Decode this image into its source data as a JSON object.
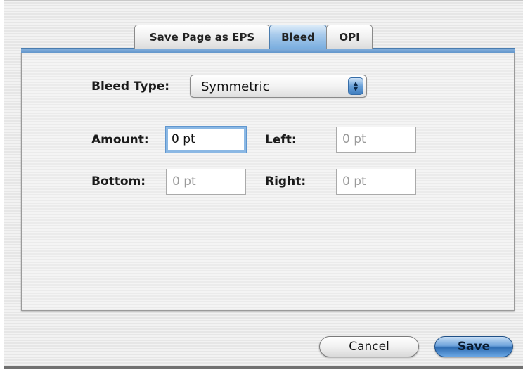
{
  "tabs": [
    {
      "label": "Save Page as EPS",
      "selected": false
    },
    {
      "label": "Bleed",
      "selected": true
    },
    {
      "label": "OPI",
      "selected": false
    }
  ],
  "bleed": {
    "type_label": "Bleed Type:",
    "type_value": "Symmetric",
    "amount_label": "Amount:",
    "amount_value": "0 pt",
    "left_label": "Left:",
    "left_value": "0 pt",
    "bottom_label": "Bottom:",
    "bottom_value": "0 pt",
    "right_label": "Right:",
    "right_value": "0 pt"
  },
  "buttons": {
    "cancel": "Cancel",
    "save": "Save"
  },
  "colors": {
    "accent": "#5d92c8",
    "focus_ring": "#8bb8e4"
  }
}
